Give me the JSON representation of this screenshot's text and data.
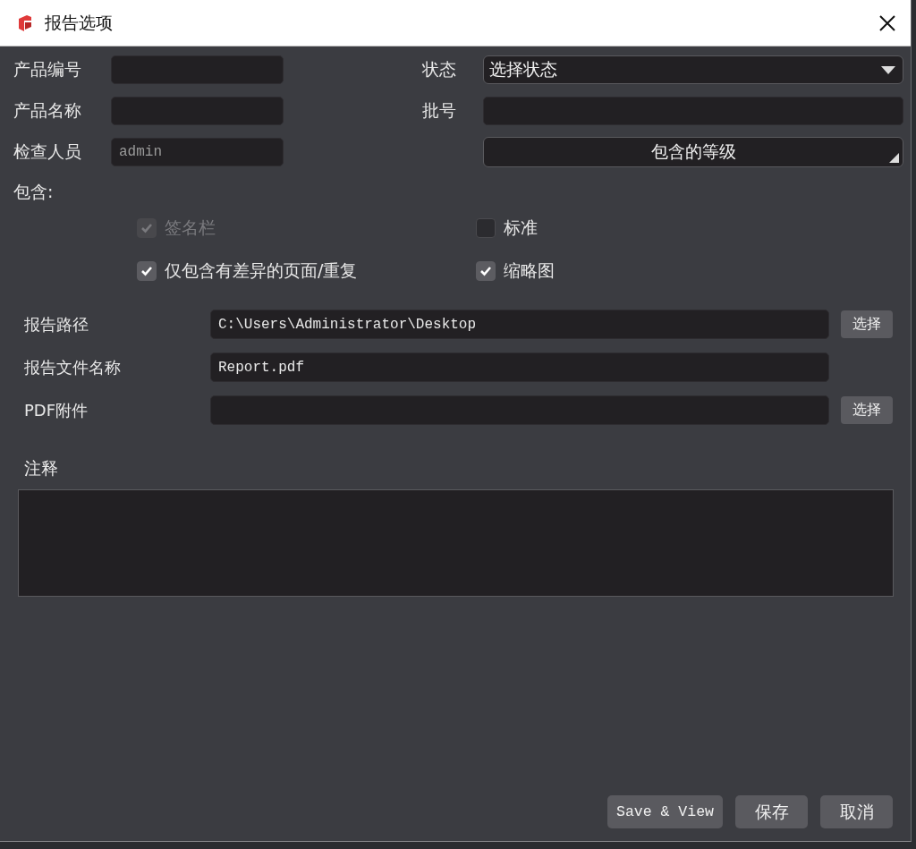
{
  "window": {
    "title": "报告选项"
  },
  "left_fields": [
    {
      "label": "产品编号"
    },
    {
      "label": "产品名称"
    },
    {
      "label": "检查人员",
      "value": "admin"
    }
  ],
  "right_fields": [
    {
      "kind": "combo",
      "label": "状态",
      "value": "选择状态"
    },
    {
      "kind": "text",
      "label": "批号"
    },
    {
      "kind": "button",
      "value": "包含的等级"
    }
  ],
  "include": {
    "label": "包含:",
    "options": [
      {
        "label": "签名栏",
        "checked": true,
        "disabled": true
      },
      {
        "label": "标准",
        "checked": false,
        "disabled": false
      },
      {
        "label": "仅包含有差异的页面/重复",
        "checked": true,
        "disabled": false
      },
      {
        "label": "缩略图",
        "checked": true,
        "disabled": false
      }
    ]
  },
  "paths": [
    {
      "label": "报告路径",
      "value": "C:\\Users\\Administrator\\Desktop",
      "button": "选择"
    },
    {
      "label": "报告文件名称",
      "value": "Report.pdf"
    },
    {
      "label": "PDF附件",
      "button": "选择"
    }
  ],
  "notes": {
    "label": "注释"
  },
  "buttons": [
    {
      "label": "Save & View",
      "kind": "mono"
    },
    {
      "label": "保存",
      "kind": "cjk"
    },
    {
      "label": "取消",
      "kind": "cjk"
    }
  ]
}
